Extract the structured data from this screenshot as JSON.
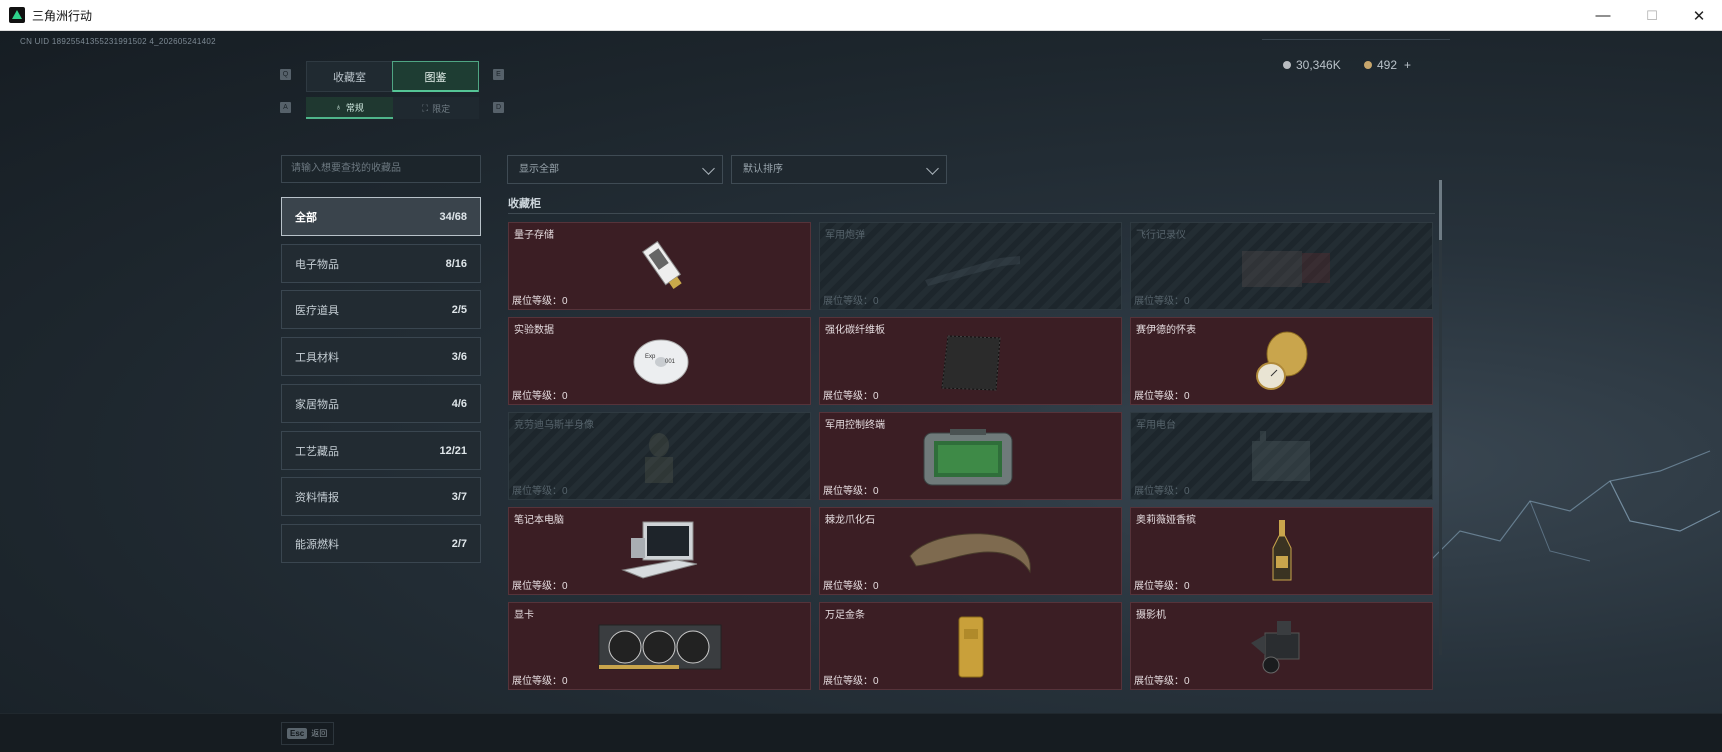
{
  "window": {
    "title": "三角洲行动",
    "minimize": "—",
    "maximize": "☐",
    "close": "✕"
  },
  "header": {
    "uid": "CN UID 18925541355231991502 4_202605241402",
    "currency_silver": "30,346K",
    "currency_gold": "492",
    "currency_add": "+"
  },
  "tabs": [
    {
      "label": "收藏室",
      "active": false
    },
    {
      "label": "图鉴",
      "active": true
    }
  ],
  "tab_keys": {
    "left": "Q",
    "right": "E"
  },
  "subtabs": [
    {
      "label": "常规",
      "active": true
    },
    {
      "label": "限定",
      "active": false
    }
  ],
  "subtab_keys": {
    "left": "A",
    "right": "D"
  },
  "search": {
    "placeholder": "请输入想要查找的收藏品"
  },
  "filters": {
    "display": "显示全部",
    "sort": "默认排序"
  },
  "categories": [
    {
      "label": "全部",
      "count": "34/68",
      "active": true
    },
    {
      "label": "电子物品",
      "count": "8/16"
    },
    {
      "label": "医疗道具",
      "count": "2/5"
    },
    {
      "label": "工具材料",
      "count": "3/6"
    },
    {
      "label": "家居物品",
      "count": "4/6"
    },
    {
      "label": "工艺藏品",
      "count": "12/21"
    },
    {
      "label": "资料情报",
      "count": "3/7"
    },
    {
      "label": "能源燃料",
      "count": "2/7"
    }
  ],
  "cabinet": {
    "title": "收藏柜",
    "level_label": "展位等级：0",
    "items": [
      {
        "name": "量子存储",
        "locked": false,
        "icon": "usb-drive-icon"
      },
      {
        "name": "军用炮弹",
        "locked": true,
        "icon": "artillery-shell-icon"
      },
      {
        "name": "飞行记录仪",
        "locked": true,
        "icon": "flight-recorder-icon"
      },
      {
        "name": "实验数据",
        "locked": false,
        "icon": "cd-disc-icon"
      },
      {
        "name": "强化碳纤维板",
        "locked": false,
        "icon": "carbon-plate-icon"
      },
      {
        "name": "赛伊德的怀表",
        "locked": false,
        "icon": "pocket-watch-icon"
      },
      {
        "name": "克劳迪乌斯半身像",
        "locked": true,
        "icon": "bust-statue-icon"
      },
      {
        "name": "军用控制终端",
        "locked": false,
        "icon": "control-terminal-icon"
      },
      {
        "name": "军用电台",
        "locked": true,
        "icon": "radio-icon"
      },
      {
        "name": "笔记本电脑",
        "locked": false,
        "icon": "laptop-icon"
      },
      {
        "name": "棘龙爪化石",
        "locked": false,
        "icon": "claw-fossil-icon"
      },
      {
        "name": "奥莉薇娅香槟",
        "locked": false,
        "icon": "champagne-bottle-icon"
      },
      {
        "name": "显卡",
        "locked": false,
        "icon": "graphics-card-icon"
      },
      {
        "name": "万足金条",
        "locked": false,
        "icon": "gold-bar-icon"
      },
      {
        "name": "摄影机",
        "locked": false,
        "icon": "camera-icon"
      }
    ]
  },
  "footer": {
    "esc_key": "Esc",
    "esc_label": "返回"
  }
}
